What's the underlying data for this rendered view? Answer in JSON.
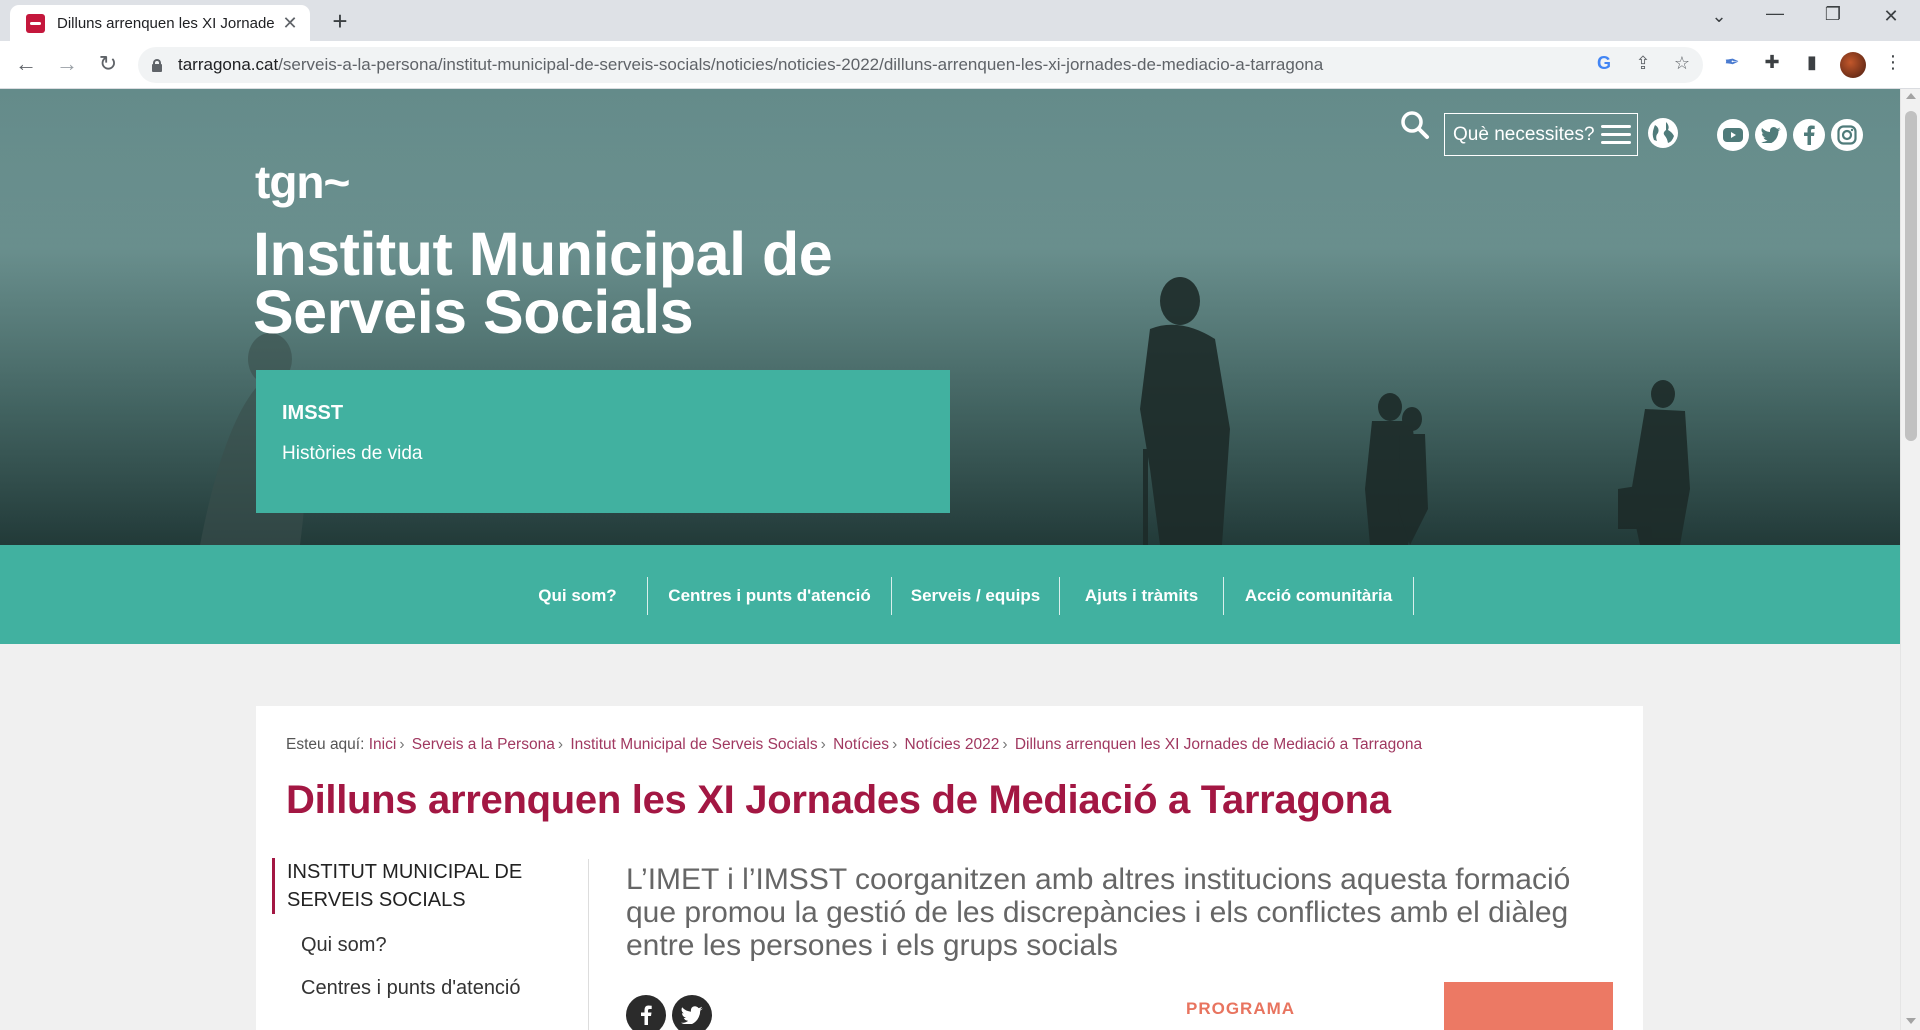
{
  "browser": {
    "tab_title": "Dilluns arrenquen les XI Jornades de Mediació a Tarragona",
    "url_domain": "tarragona.cat",
    "url_path": "/serveis-a-la-persona/institut-municipal-de-serveis-socials/noticies/noticies-2022/dilluns-arrenquen-les-xi-jornades-de-mediacio-a-tarragona"
  },
  "header": {
    "logo": "tgn~",
    "title": "Institut Municipal de Serveis Socials",
    "menu_label": "Què necessites?",
    "icons": [
      "search-icon",
      "globe-icon",
      "youtube-icon",
      "twitter-icon",
      "facebook-icon",
      "instagram-icon"
    ]
  },
  "hero_box": {
    "title": "IMSST",
    "subtitle": "Històries de vida"
  },
  "main_nav": {
    "items": [
      "Qui som?",
      "Centres i punts d'atenció",
      "Serveis / equips",
      "Ajuts i tràmits",
      "Acció comunitària"
    ]
  },
  "breadcrumb": {
    "prefix": "Esteu aquí:",
    "items": [
      "Inici",
      "Serveis a la Persona",
      "Institut Municipal de Serveis Socials",
      "Notícies",
      "Notícies 2022",
      "Dilluns arrenquen les XI Jornades de Mediació a Tarragona"
    ]
  },
  "article": {
    "title": "Dilluns arrenquen les XI Jornades de Mediació a Tarragona",
    "lead": "L’IMET i l’IMSST coorganitzen amb altres institucions aquesta formació que promou la gestió de les discrepàncies i els conflictes amb el diàleg entre les persones i els grups socials",
    "program_label": "PROGRAMA"
  },
  "sidebar": {
    "heading": "INSTITUT MUNICIPAL DE SERVEIS SOCIALS",
    "items": [
      "Qui som?",
      "Centres i punts d'atenció"
    ]
  },
  "colors": {
    "accent": "#a31743",
    "teal": "#41b1a0",
    "breadcrumb_link": "#a03860",
    "program": "#e8745f"
  }
}
